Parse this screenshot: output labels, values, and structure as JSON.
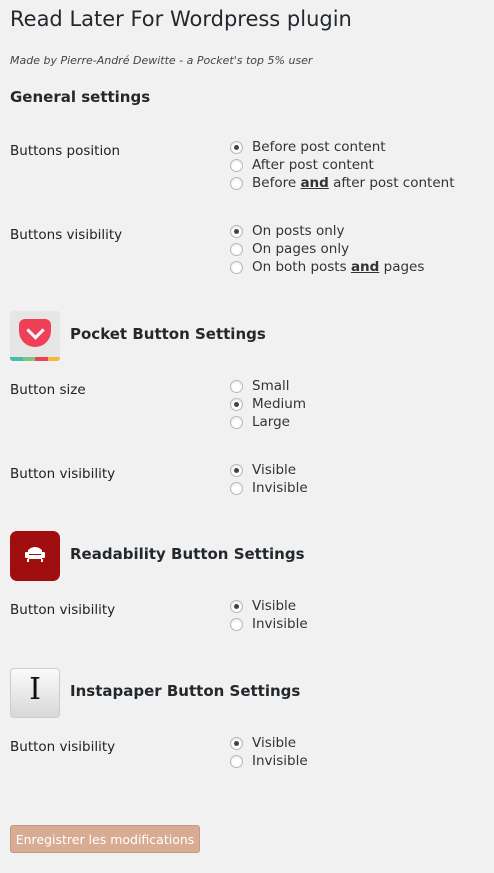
{
  "page": {
    "title": "Read Later For Wordpress plugin",
    "subtitle": "Made by Pierre-André Dewitte - a Pocket's top 5% user"
  },
  "general": {
    "heading": "General settings",
    "position": {
      "label": "Buttons position",
      "options": [
        {
          "pre": "Before post content",
          "u": "",
          "post": "",
          "checked": true
        },
        {
          "pre": "After post content",
          "u": "",
          "post": "",
          "checked": false
        },
        {
          "pre": "Before ",
          "u": "and",
          "post": " after post content",
          "checked": false
        }
      ]
    },
    "visibility": {
      "label": "Buttons visibility",
      "options": [
        {
          "pre": "On posts only",
          "u": "",
          "post": "",
          "checked": true
        },
        {
          "pre": "On pages only",
          "u": "",
          "post": "",
          "checked": false
        },
        {
          "pre": "On both posts ",
          "u": "and",
          "post": " pages",
          "checked": false
        }
      ]
    }
  },
  "pocket": {
    "heading": "Pocket Button Settings",
    "icon": "pocket-logo-icon",
    "colors": {
      "brand": "#ee4056"
    },
    "size": {
      "label": "Button size",
      "options": [
        {
          "label": "Small",
          "checked": false
        },
        {
          "label": "Medium",
          "checked": true
        },
        {
          "label": "Large",
          "checked": false
        }
      ]
    },
    "visibility": {
      "label": "Button visibility",
      "options": [
        {
          "label": "Visible",
          "checked": true
        },
        {
          "label": "Invisible",
          "checked": false
        }
      ]
    }
  },
  "readability": {
    "heading": "Readability Button Settings",
    "icon": "readability-logo-icon",
    "colors": {
      "brand": "#a10e10"
    },
    "visibility": {
      "label": "Button visibility",
      "options": [
        {
          "label": "Visible",
          "checked": true
        },
        {
          "label": "Invisible",
          "checked": false
        }
      ]
    }
  },
  "instapaper": {
    "heading": "Instapaper Button Settings",
    "icon": "instapaper-logo-icon",
    "visibility": {
      "label": "Button visibility",
      "options": [
        {
          "label": "Visible",
          "checked": true
        },
        {
          "label": "Invisible",
          "checked": false
        }
      ]
    }
  },
  "footer": {
    "save_label": "Enregistrer les modifications",
    "colors": {
      "button": "#d7ac93"
    }
  }
}
